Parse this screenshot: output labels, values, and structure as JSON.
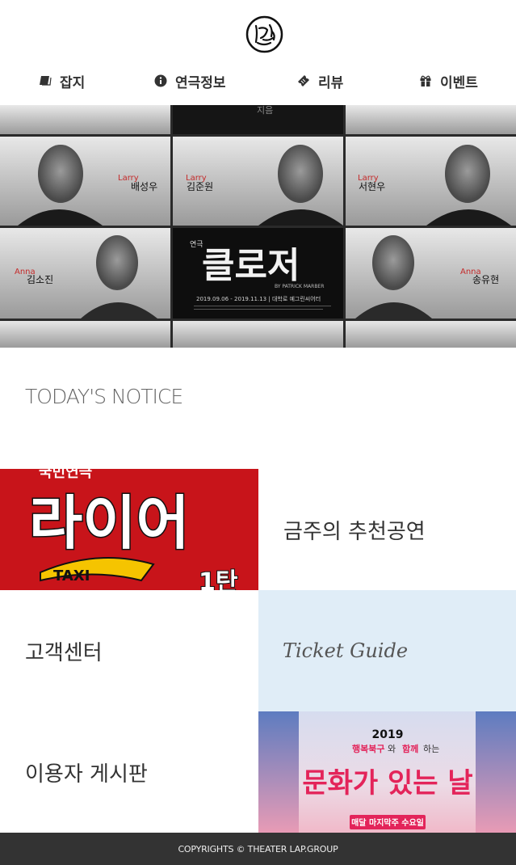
{
  "nav": {
    "items": [
      {
        "label": "잡지",
        "icon": "book-icon"
      },
      {
        "label": "연극정보",
        "icon": "info-icon"
      },
      {
        "label": "리뷰",
        "icon": "ticket-icon"
      },
      {
        "label": "이벤트",
        "icon": "gift-icon"
      }
    ]
  },
  "hero": {
    "genre": "연극",
    "title": "클로저",
    "byline": "BY PATRICK MARBER",
    "dates": "2019.09.06 - 2019.11.13 | 대학로 예그린씨어터",
    "cast": [
      {
        "role": "Larry",
        "name": "배성우"
      },
      {
        "role": "Larry",
        "name": "김준원"
      },
      {
        "role": "Larry",
        "name": "서현우"
      },
      {
        "role": "Anna",
        "name": "김소진"
      },
      {
        "role": "Anna",
        "name": "송유현"
      }
    ],
    "top_fragment": "지음"
  },
  "notice": {
    "title": "TODAY'S NOTICE"
  },
  "tiles": {
    "featured_poster_title": "라이어",
    "featured_poster_sub": "1탄",
    "featured_poster_taxi": "TAXI",
    "featured_poster_top": "국민연극",
    "recommended": "금주의 추천공연",
    "customer_center": "고객센터",
    "ticket_guide": "Ticket Guide",
    "user_board": "이용자 게시판"
  },
  "culture": {
    "year": "2019",
    "subtitle_a": "행복북구",
    "subtitle_b": "와 ",
    "subtitle_c": "함께",
    "subtitle_d": "하는",
    "title": "문화가 있는 날",
    "foot": "매달 마지막주 수요일"
  },
  "footer": {
    "text": "COPYRIGHTS © THEATER LAP.GROUP"
  },
  "colors": {
    "red": "#c8141a",
    "guide_bg": "#e0edf7",
    "footer_bg": "#333333"
  }
}
